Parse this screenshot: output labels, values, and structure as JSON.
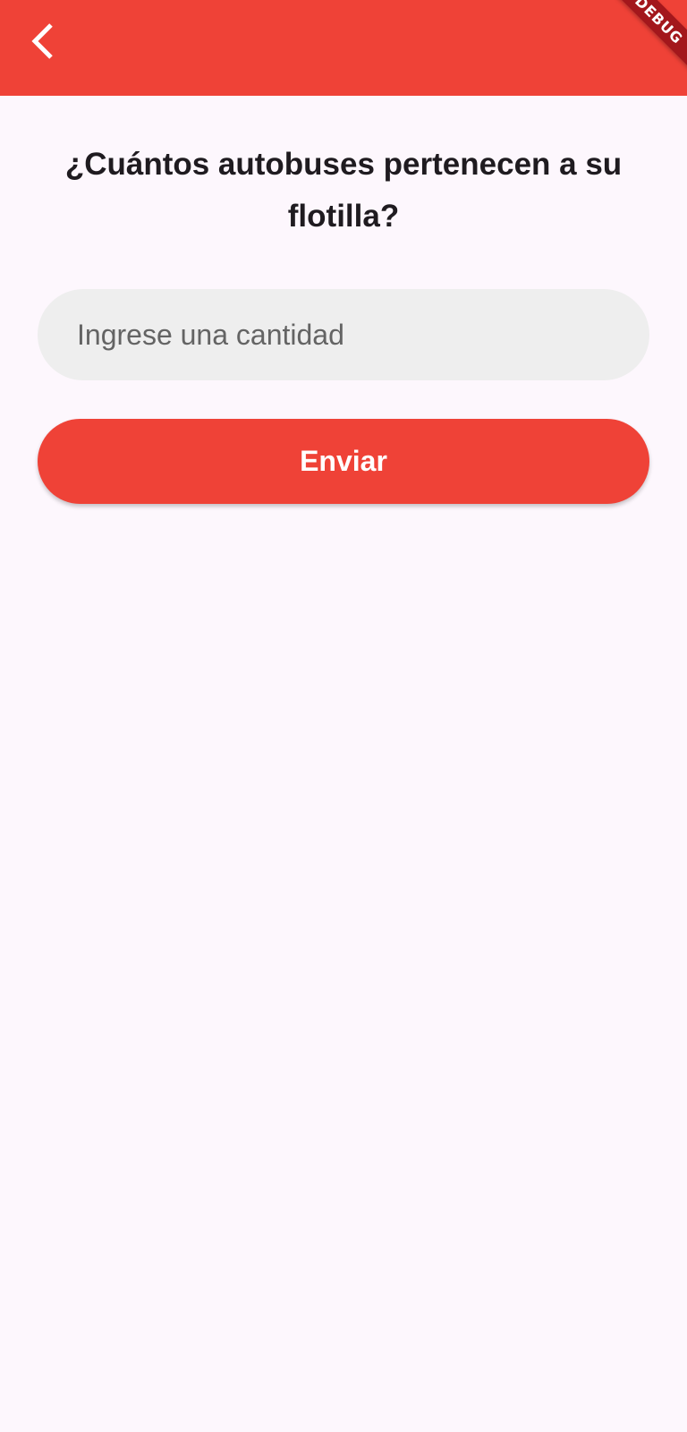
{
  "colors": {
    "app_bar": "#ef4237",
    "background": "#fdf7fd",
    "input_fill": "#eeeeee",
    "button": "#ef4237",
    "debug_banner": "#a3171c"
  },
  "app_bar": {
    "back_icon": "chevron-left-icon",
    "debug_banner": "DEBUG"
  },
  "main": {
    "question": "¿Cuántos autobuses pertenecen a su flotilla?",
    "amount_input": {
      "value": "",
      "placeholder": "Ingrese una cantidad"
    },
    "submit_label": "Enviar"
  }
}
